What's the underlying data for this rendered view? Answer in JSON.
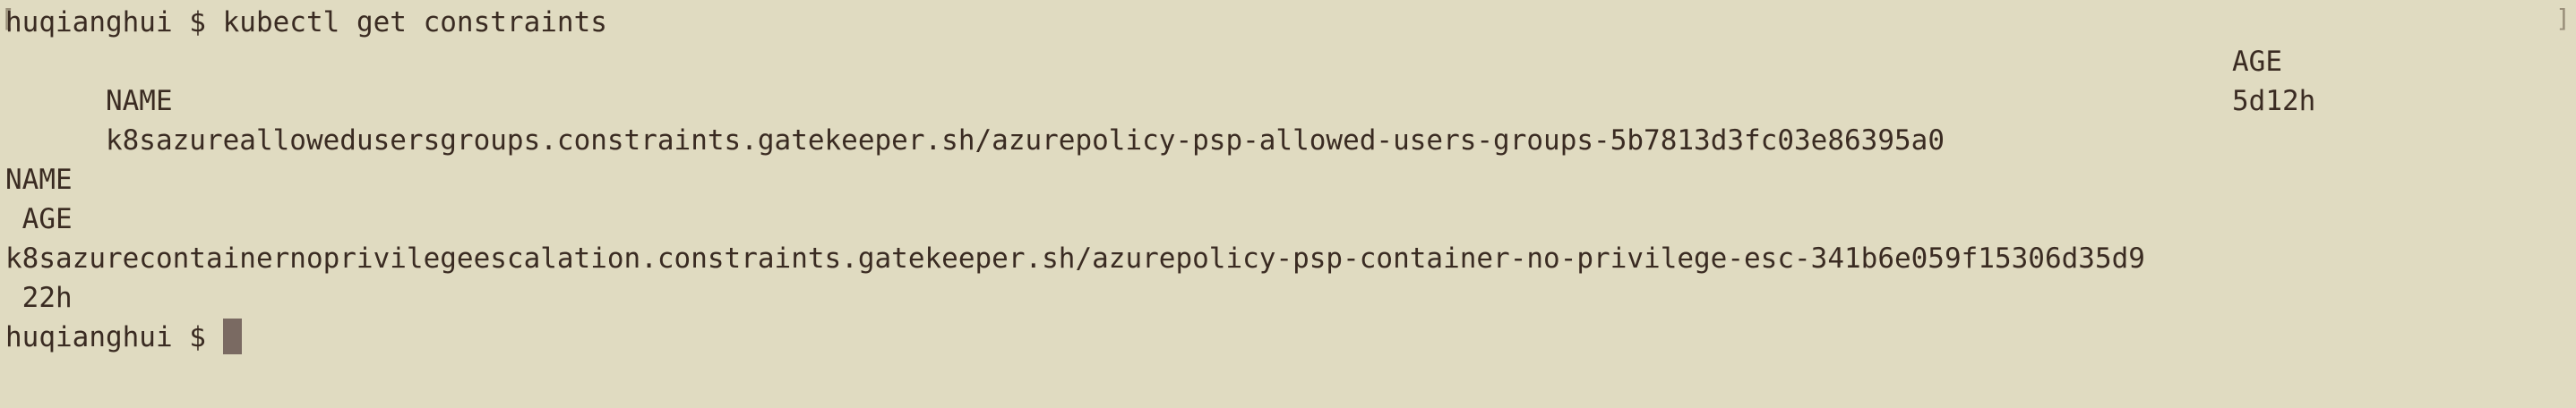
{
  "terminal": {
    "edge_left": "[",
    "edge_right": "]",
    "prompt": "huqianghui $ ",
    "command": "kubectl get constraints",
    "output1": {
      "header_name": "NAME",
      "header_age": "AGE",
      "row_name": "k8sazureallowedusersgroups.constraints.gatekeeper.sh/azurepolicy-psp-allowed-users-groups-5b7813d3fc03e86395a0",
      "row_age": "5d12h"
    },
    "output2": {
      "header_name": "NAME",
      "header_age": " AGE",
      "row_name": "k8sazurecontainernoprivilegeescalation.constraints.gatekeeper.sh/azurepolicy-psp-container-no-privilege-esc-341b6e059f15306d35d9",
      "row_age": " 22h"
    },
    "final_prompt": "huqianghui $ "
  },
  "colors": {
    "background": "#e0dbc1",
    "foreground": "#3a2b22",
    "cursor": "#7a6a62"
  }
}
